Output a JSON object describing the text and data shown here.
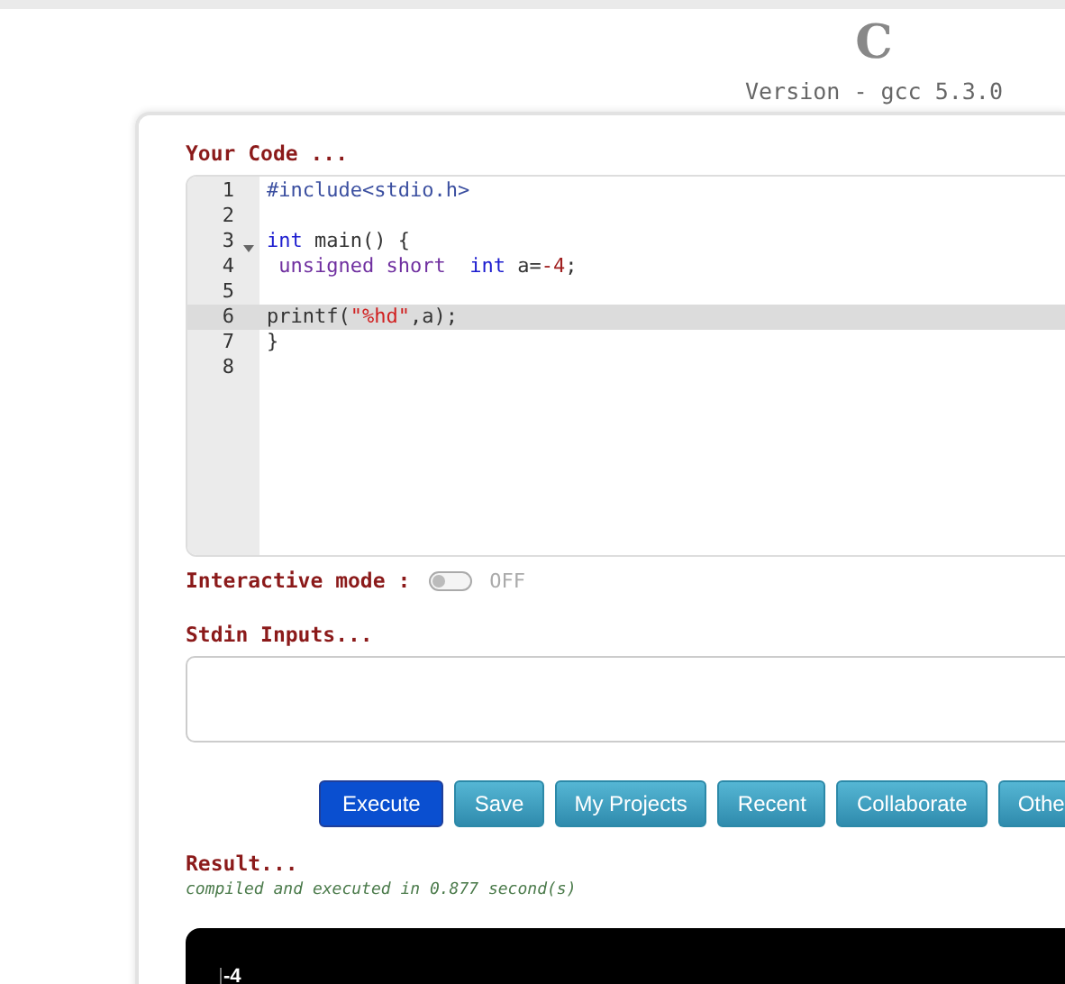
{
  "header": {
    "logo": "C",
    "version": "Version - gcc 5.3.0"
  },
  "editor": {
    "label": "Your Code ...",
    "lines": [
      {
        "number": "1",
        "foldable": false,
        "active": false,
        "tokens": [
          {
            "kind": "directive",
            "text": "#include<stdio.h>"
          }
        ]
      },
      {
        "number": "2",
        "foldable": false,
        "active": false
      },
      {
        "number": "3",
        "foldable": true,
        "active": false,
        "tokens": [
          {
            "kind": "keyword",
            "text": "int"
          },
          {
            "kind": "plain",
            "text": " main() {"
          }
        ]
      },
      {
        "number": "4",
        "foldable": false,
        "active": false,
        "tokens": [
          {
            "kind": "type",
            "text": " unsigned short"
          },
          {
            "kind": "keyword",
            "text": "  int"
          },
          {
            "kind": "plain",
            "text": " a="
          },
          {
            "kind": "number",
            "text": "-4"
          },
          {
            "kind": "plain",
            "text": ";"
          }
        ]
      },
      {
        "number": "5",
        "foldable": false,
        "active": false
      },
      {
        "number": "6",
        "foldable": false,
        "active": true,
        "tokens": [
          {
            "kind": "plain",
            "text": "printf("
          },
          {
            "kind": "string",
            "text": "\"%hd\""
          },
          {
            "kind": "plain",
            "text": ",a);"
          }
        ]
      },
      {
        "number": "7",
        "foldable": false,
        "active": false,
        "tokens": [
          {
            "kind": "plain",
            "text": "}"
          }
        ]
      },
      {
        "number": "8",
        "foldable": false,
        "active": false
      }
    ]
  },
  "interactive": {
    "label": "Interactive mode :",
    "on": false,
    "state_text": "OFF"
  },
  "stdin": {
    "label": "Stdin Inputs..."
  },
  "buttons": [
    {
      "label": "Execute",
      "kind": "primary"
    },
    {
      "label": "Save",
      "kind": "secondary"
    },
    {
      "label": "My Projects",
      "kind": "secondary"
    },
    {
      "label": "Recent",
      "kind": "secondary"
    },
    {
      "label": "Collaborate",
      "kind": "secondary"
    },
    {
      "label": "Othe",
      "kind": "secondary"
    }
  ],
  "result": {
    "label": "Result...",
    "status": "compiled and executed in 0.877 second(s)",
    "output": "-4"
  }
}
